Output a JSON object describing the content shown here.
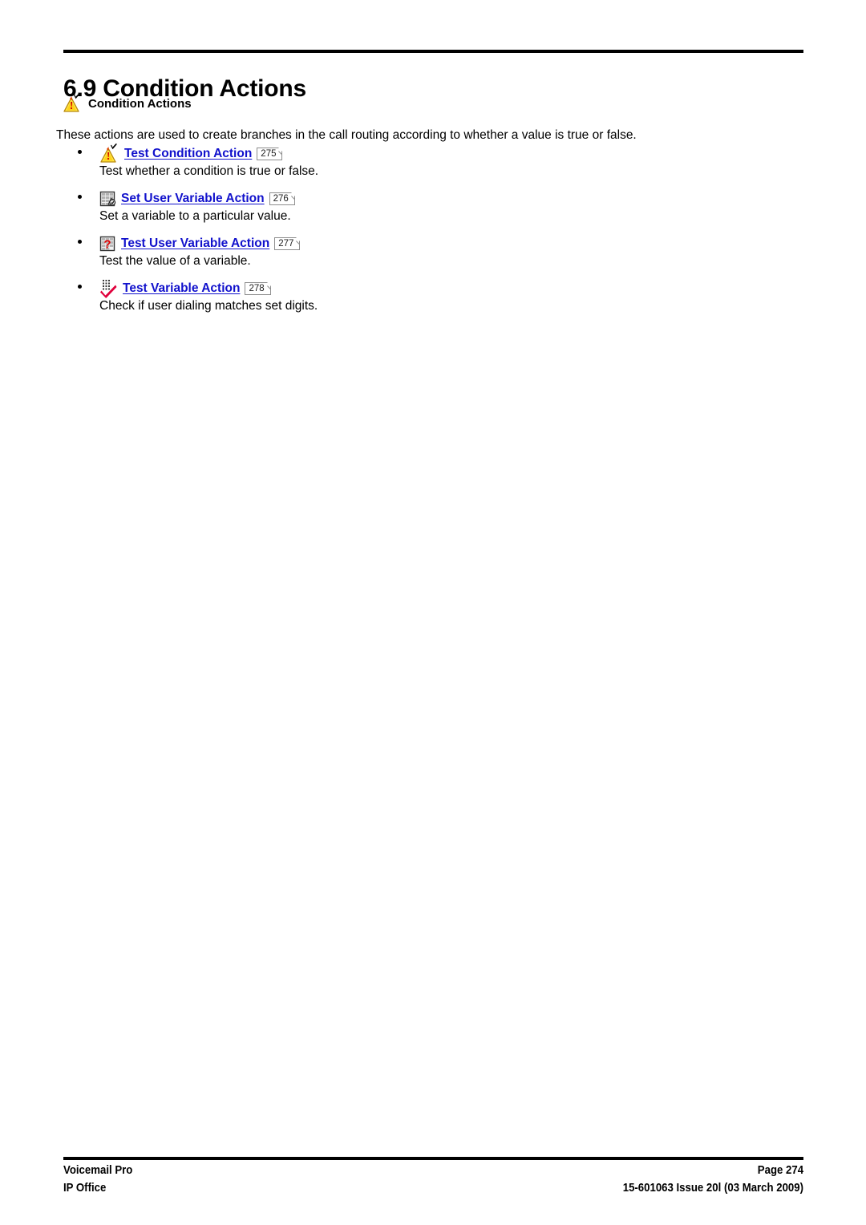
{
  "document": {
    "heading": "6.9 Condition Actions",
    "subheading": "Condition Actions",
    "subheading_icon": "warning-triangle-check-icon",
    "intro": "These actions are used to create branches in the call routing according to whether a value is true or false."
  },
  "actions": [
    {
      "icon": "warning-triangle-check-icon",
      "link": "Test Condition Action",
      "pageref": "275",
      "description": "Test whether a condition is true or false."
    },
    {
      "icon": "grid-pencil-icon",
      "link": "Set User Variable Action",
      "pageref": "276",
      "description": "Set a variable to a particular value."
    },
    {
      "icon": "grid-question-mark-icon",
      "link": "Test User Variable Action",
      "pageref": "277",
      "description": "Test the value of a variable."
    },
    {
      "icon": "keypad-check-icon",
      "link": "Test Variable Action",
      "pageref": "278",
      "description": "Check if user dialing matches set digits."
    }
  ],
  "footer": {
    "left_line1": "Voicemail Pro",
    "left_line2": "IP Office",
    "right_line1": "Page 274",
    "right_line2": "15-601063 Issue 20l (03 March 2009)"
  },
  "colors": {
    "link": "#1111CC",
    "text": "#000000",
    "warning_yellow": "#FFD700",
    "accent_red": "#D4003C"
  }
}
